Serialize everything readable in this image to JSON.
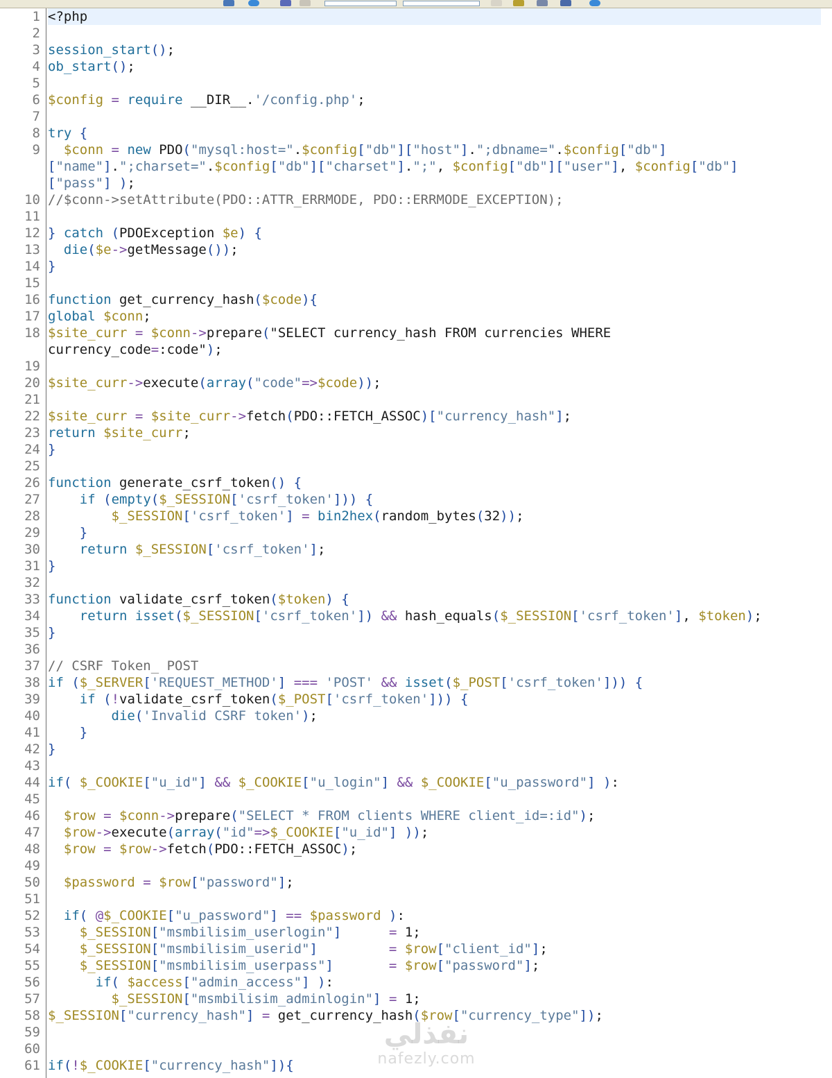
{
  "editor": {
    "current_line": 1,
    "rows": [
      {
        "n": "1",
        "code": "<?php"
      },
      {
        "n": "2",
        "code": ""
      },
      {
        "n": "3",
        "code": "session_start();"
      },
      {
        "n": "4",
        "code": "ob_start();"
      },
      {
        "n": "5",
        "code": ""
      },
      {
        "n": "6",
        "code": "$config = require __DIR__.'/config.php';"
      },
      {
        "n": "7",
        "code": ""
      },
      {
        "n": "8",
        "code": "try {"
      },
      {
        "n": "9",
        "code": "  $conn = new PDO(\"mysql:host=\".$config[\"db\"][\"host\"].\";dbname=\".$config[\"db\"]"
      },
      {
        "n": "",
        "code": "[\"name\"].\";charset=\".$config[\"db\"][\"charset\"].\";\", $config[\"db\"][\"user\"], $config[\"db\"]"
      },
      {
        "n": "",
        "code": "[\"pass\"] );"
      },
      {
        "n": "10",
        "code": "//$conn->setAttribute(PDO::ATTR_ERRMODE, PDO::ERRMODE_EXCEPTION);"
      },
      {
        "n": "11",
        "code": ""
      },
      {
        "n": "12",
        "code": "} catch (PDOException $e) {"
      },
      {
        "n": "13",
        "code": "  die($e->getMessage());"
      },
      {
        "n": "14",
        "code": "}"
      },
      {
        "n": "15",
        "code": ""
      },
      {
        "n": "16",
        "code": "function get_currency_hash($code){"
      },
      {
        "n": "17",
        "code": "global $conn;"
      },
      {
        "n": "18",
        "code": "$site_curr = $conn->prepare(\"SELECT currency_hash FROM currencies WHERE"
      },
      {
        "n": "",
        "code": "currency_code=:code\");"
      },
      {
        "n": "19",
        "code": ""
      },
      {
        "n": "20",
        "code": "$site_curr->execute(array(\"code\"=>$code));"
      },
      {
        "n": "21",
        "code": ""
      },
      {
        "n": "22",
        "code": "$site_curr = $site_curr->fetch(PDO::FETCH_ASSOC)[\"currency_hash\"];"
      },
      {
        "n": "23",
        "code": "return $site_curr;"
      },
      {
        "n": "24",
        "code": "}"
      },
      {
        "n": "25",
        "code": ""
      },
      {
        "n": "26",
        "code": "function generate_csrf_token() {"
      },
      {
        "n": "27",
        "code": "    if (empty($_SESSION['csrf_token'])) {"
      },
      {
        "n": "28",
        "code": "        $_SESSION['csrf_token'] = bin2hex(random_bytes(32));"
      },
      {
        "n": "29",
        "code": "    }"
      },
      {
        "n": "30",
        "code": "    return $_SESSION['csrf_token'];"
      },
      {
        "n": "31",
        "code": "}"
      },
      {
        "n": "32",
        "code": ""
      },
      {
        "n": "33",
        "code": "function validate_csrf_token($token) {"
      },
      {
        "n": "34",
        "code": "    return isset($_SESSION['csrf_token']) && hash_equals($_SESSION['csrf_token'], $token);"
      },
      {
        "n": "35",
        "code": "}"
      },
      {
        "n": "36",
        "code": ""
      },
      {
        "n": "37",
        "code": "// CSRF Token_ POST"
      },
      {
        "n": "38",
        "code": "if ($_SERVER['REQUEST_METHOD'] === 'POST' && isset($_POST['csrf_token'])) {"
      },
      {
        "n": "39",
        "code": "    if (!validate_csrf_token($_POST['csrf_token'])) {"
      },
      {
        "n": "40",
        "code": "        die('Invalid CSRF token');"
      },
      {
        "n": "41",
        "code": "    }"
      },
      {
        "n": "42",
        "code": "}"
      },
      {
        "n": "43",
        "code": ""
      },
      {
        "n": "44",
        "code": "if( $_COOKIE[\"u_id\"] && $_COOKIE[\"u_login\"] && $_COOKIE[\"u_password\"] ):"
      },
      {
        "n": "45",
        "code": ""
      },
      {
        "n": "46",
        "code": "  $row = $conn->prepare(\"SELECT * FROM clients WHERE client_id=:id\");"
      },
      {
        "n": "47",
        "code": "  $row->execute(array(\"id\"=>$_COOKIE[\"u_id\"] ));"
      },
      {
        "n": "48",
        "code": "  $row = $row->fetch(PDO::FETCH_ASSOC);"
      },
      {
        "n": "49",
        "code": ""
      },
      {
        "n": "50",
        "code": "  $password = $row[\"password\"];"
      },
      {
        "n": "51",
        "code": ""
      },
      {
        "n": "52",
        "code": "  if( @$_COOKIE[\"u_password\"] == $password ):"
      },
      {
        "n": "53",
        "code": "    $_SESSION[\"msmbilisim_userlogin\"]      = 1;"
      },
      {
        "n": "54",
        "code": "    $_SESSION[\"msmbilisim_userid\"]         = $row[\"client_id\"];"
      },
      {
        "n": "55",
        "code": "    $_SESSION[\"msmbilisim_userpass\"]       = $row[\"password\"];"
      },
      {
        "n": "56",
        "code": "      if( $access[\"admin_access\"] ):"
      },
      {
        "n": "57",
        "code": "        $_SESSION[\"msmbilisim_adminlogin\"] = 1;"
      },
      {
        "n": "58",
        "code": "$_SESSION[\"currency_hash\"] = get_currency_hash($row[\"currency_type\"]);"
      },
      {
        "n": "59",
        "code": ""
      },
      {
        "n": "60",
        "code": ""
      },
      {
        "n": "61",
        "code": "if(!$_COOKIE[\"currency_hash\"]){"
      }
    ]
  },
  "watermark": {
    "arabic": "نفذلي",
    "latin": "nafezly.com"
  }
}
